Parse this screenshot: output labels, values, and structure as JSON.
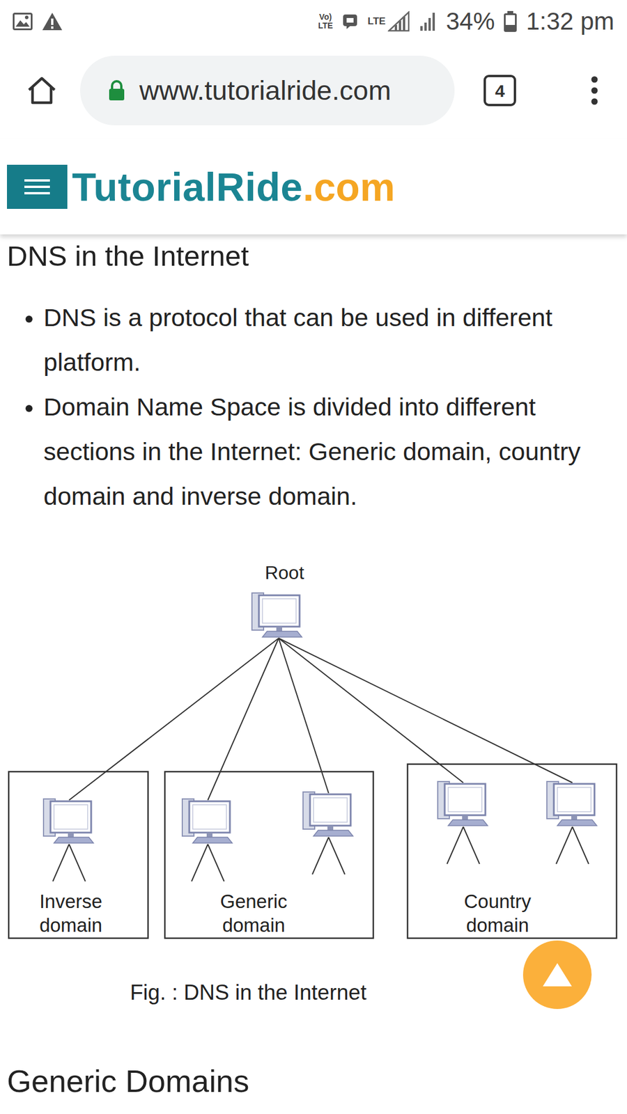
{
  "status_bar": {
    "volte_top": "Vo)",
    "volte_bottom": "LTE",
    "data_type": "LTE",
    "battery": "34%",
    "battery_level": 0.34,
    "time": "1:32 pm"
  },
  "browser": {
    "url": "www.tutorialride.com",
    "secure": true,
    "tab_count": "4"
  },
  "site": {
    "logo_name": "TutorialRide",
    "logo_tld": ".com"
  },
  "article": {
    "title": "DNS in the Internet",
    "bullets": [
      "DNS is a protocol that can be used in different platform.",
      "Domain Name Space is divided into different sections in the Internet: Generic domain, country domain and inverse domain."
    ],
    "figure": {
      "root": "Root",
      "groups": [
        {
          "label": [
            "Inverse",
            "domain"
          ],
          "hosts": 1
        },
        {
          "label": [
            "Generic",
            "domain"
          ],
          "hosts": 2
        },
        {
          "label": [
            "Country",
            "domain"
          ],
          "hosts": 2
        }
      ],
      "caption": "Fig. : DNS in the Internet"
    },
    "next_heading": "Generic Domains"
  }
}
